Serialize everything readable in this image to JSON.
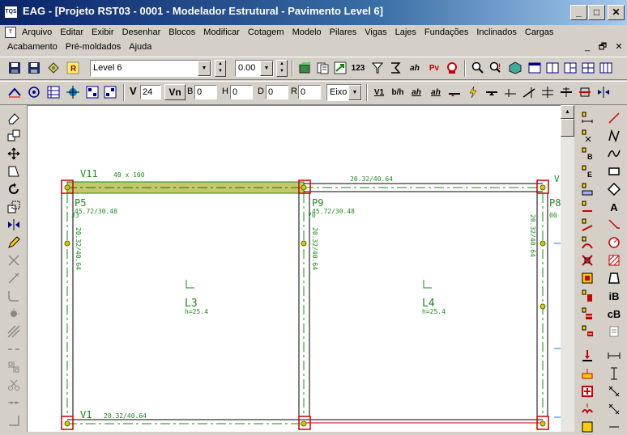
{
  "window": {
    "app_icon_label": "TQS",
    "title": "EAG - [Projeto RST03 - 0001 - Modelador Estrutural - Pavimento Level 6]",
    "minimize": "_",
    "maximize": "□",
    "close": "✕"
  },
  "menu": {
    "row1": [
      "Arquivo",
      "Editar",
      "Exibir",
      "Desenhar",
      "Blocos",
      "Modificar",
      "Cotagem",
      "Modelo",
      "Pilares",
      "Vigas",
      "Lajes",
      "Fundações",
      "Inclinados",
      "Cargas"
    ],
    "row2": [
      "Acabamento",
      "Pré-moldados",
      "Ajuda"
    ],
    "mdi_minimize": "_",
    "mdi_restore": "🗗",
    "mdi_close": "✕"
  },
  "toolbar1": {
    "floor_select": "Level 6",
    "elevation_select": "0.00",
    "btn_123": "123",
    "btn_ah": "ah",
    "btn_pv": "Pv"
  },
  "toolbar2": {
    "v_label": "V",
    "v_value": "24",
    "vn_label": "Vn",
    "b_label": "B",
    "b_value": "0",
    "h_label": "H",
    "h_value": "0",
    "d_label": "D",
    "d_value": "0",
    "r_label": "R",
    "r_value": "0",
    "axis_select": "Eixo",
    "btn_v1": "V1",
    "btn_bh": "b/h",
    "btn_ah1": "ah",
    "btn_ah2": "ah"
  },
  "drawing": {
    "beam_v11": "V11",
    "beam_v11_dims": "40 x 100",
    "beam_top_right_dims": "20.32/40.64",
    "beam_right_label": "V",
    "beam_v1": "V1",
    "beam_v1_dims": "20.32/40.64",
    "pillar_p5": "P5",
    "pillar_p5_dims": "45.72/30.48",
    "pillar_p9": "P9",
    "pillar_p9_dims": "45.72/30.48",
    "pillar_p_right": "P8",
    "pillar_p_right_dims": "00",
    "pillar_left_code": "J3",
    "pillar_mid_code": "70",
    "beam_left_vert_dims": "20.32/40.64",
    "beam_mid_vert_dims": "20.32/40.64",
    "beam_right_vert_dims": "20.32/40.64",
    "slab_l3": "L3",
    "slab_l3_h": "h=25.4",
    "slab_l4": "L4",
    "slab_l4_h": "h=25.4"
  },
  "right_toolbar": {
    "text_a": "A",
    "text_ib": "iB",
    "text_cb": "cB"
  },
  "colors": {
    "title_gradient_start": "#0a246a",
    "title_gradient_end": "#a6caf0",
    "cad_green": "#1a8a1a",
    "beam_fill": "#c5c86a",
    "pillar_red": "#cc0000"
  }
}
